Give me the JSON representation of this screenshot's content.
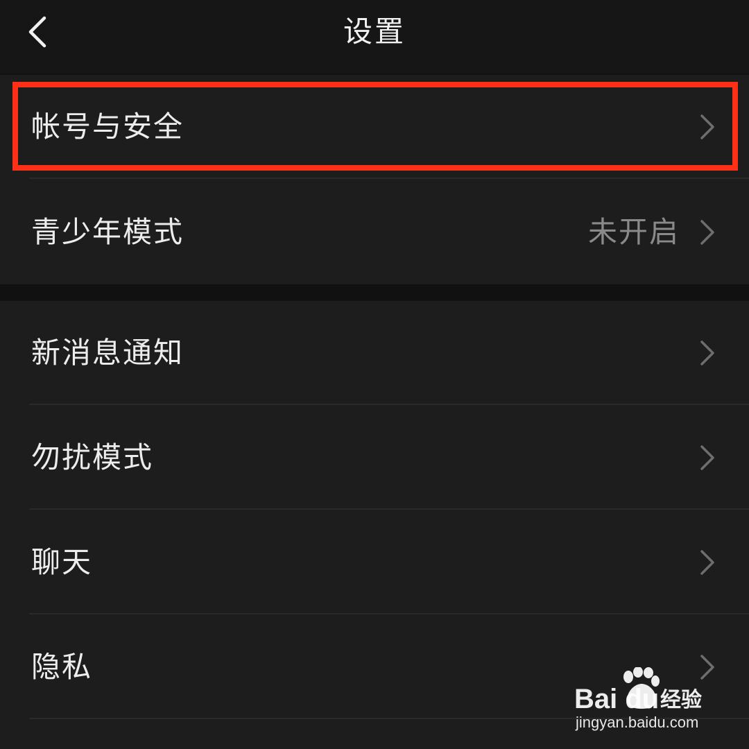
{
  "header": {
    "title": "设置",
    "back_icon": "chevron-left-icon"
  },
  "groups": [
    {
      "items": [
        {
          "label": "帐号与安全",
          "value": "",
          "icon": "chevron-right-icon",
          "highlighted": true
        },
        {
          "label": "青少年模式",
          "value": "未开启",
          "icon": "chevron-right-icon"
        }
      ]
    },
    {
      "items": [
        {
          "label": "新消息通知",
          "icon": "chevron-right-icon"
        },
        {
          "label": "勿扰模式",
          "icon": "chevron-right-icon"
        },
        {
          "label": "聊天",
          "icon": "chevron-right-icon"
        },
        {
          "label": "隐私",
          "icon": "chevron-right-icon"
        }
      ]
    }
  ],
  "annotation": {
    "highlight_color": "#ff3018"
  },
  "watermark": {
    "brand": "Bai du",
    "product": "经验",
    "url": "jingyan.baidu.com"
  },
  "colors": {
    "background": "#111111",
    "header": "#161616",
    "row": "#1d1d1d",
    "text": "#ededed",
    "secondary_text": "#8a8a8a"
  }
}
